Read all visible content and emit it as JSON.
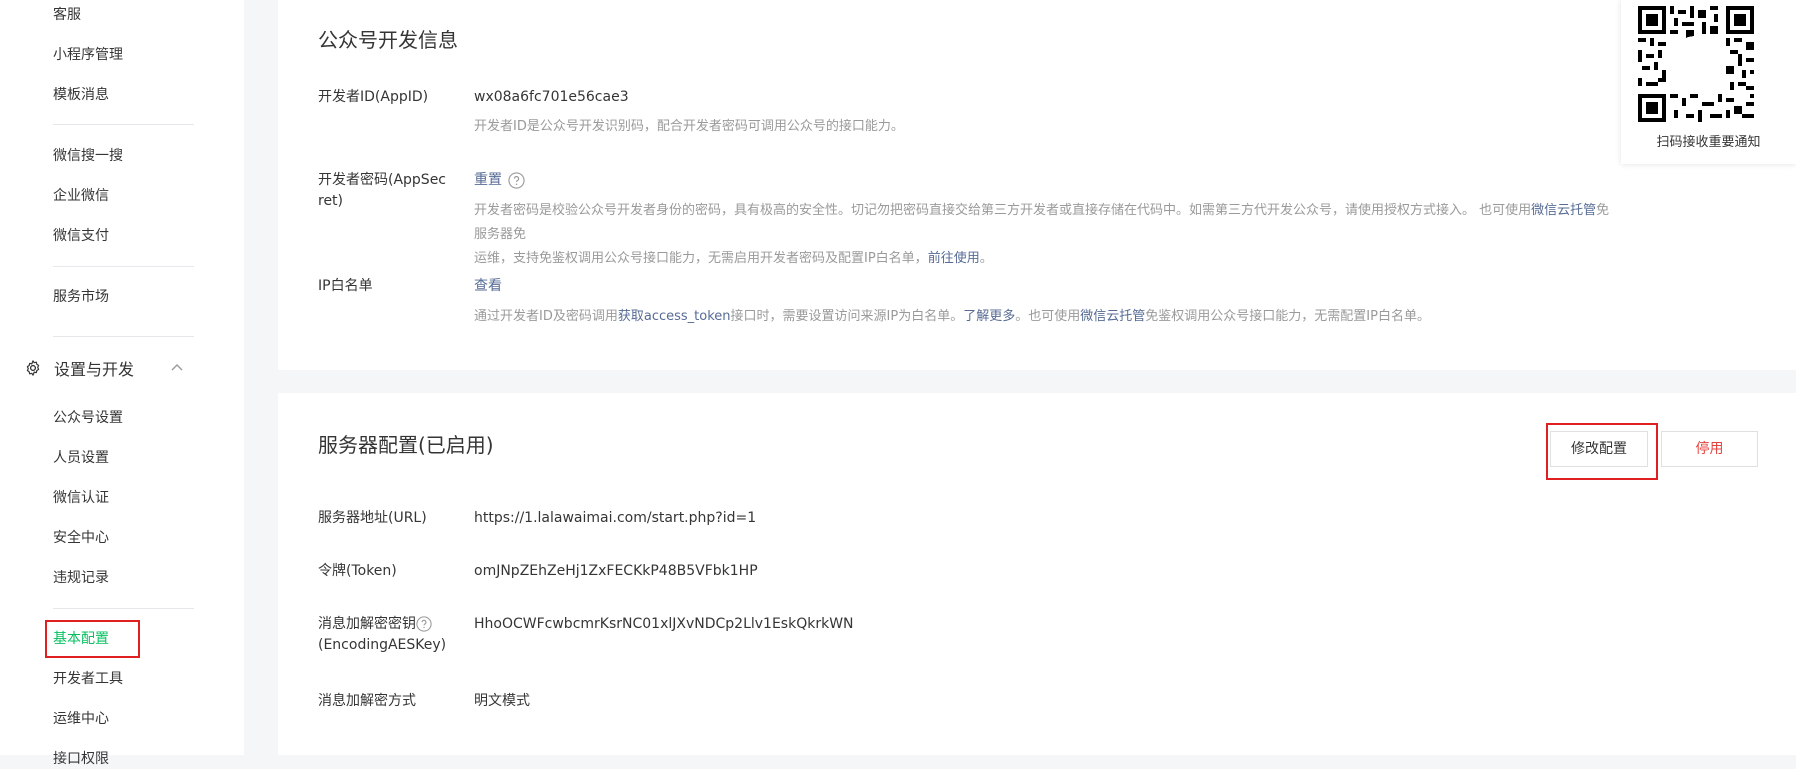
{
  "sidebar": {
    "items_top": [
      "客服",
      "小程序管理",
      "模板消息"
    ],
    "items_group2": [
      "微信搜一搜",
      "企业微信",
      "微信支付"
    ],
    "items_group3": [
      "服务市场"
    ],
    "section_settings": {
      "label": "设置与开发",
      "icon": "gear-icon",
      "expanded": true
    },
    "items_settings": [
      "公众号设置",
      "人员设置",
      "微信认证",
      "安全中心",
      "违规记录"
    ],
    "items_bottom": [
      "基本配置",
      "开发者工具",
      "运维中心",
      "接口权限"
    ],
    "active_item": "基本配置"
  },
  "dev_info": {
    "title": "公众号开发信息",
    "appid_label": "开发者ID(AppID)",
    "appid_value": "wx08a6fc701e56cae3",
    "appid_desc": "开发者ID是公众号开发识别码，配合开发者密码可调用公众号的接口能力。",
    "secret_label_1": "开发者密码(AppSec",
    "secret_label_2": "ret)",
    "secret_reset": "重置",
    "secret_desc_1": "开发者密码是校验公众号开发者身份的密码，具有极高的安全性。切记勿把密码直接交给第三方开发者或直接存储在代码中。如需第三方代开发公众号，请使用授权方式接入。 也可使用",
    "secret_desc_link1": "微信云托管",
    "secret_desc_2": "免服务器免",
    "secret_desc_3": "运维，支持免鉴权调用公众号接口能力，无需启用开发者密码及配置IP白名单，",
    "secret_desc_link2": "前往使用",
    "secret_desc_4": "。",
    "ip_label": "IP白名单",
    "ip_view": "查看",
    "ip_desc_1": "通过开发者ID及密码调用",
    "ip_desc_link1": "获取access_token",
    "ip_desc_2": "接口时，需要设置访问来源IP为白名单。",
    "ip_desc_link2": "了解更多",
    "ip_desc_3": "。也可使用",
    "ip_desc_link3": "微信云托管",
    "ip_desc_4": "免鉴权调用公众号接口能力，无需配置IP白名单。"
  },
  "server_config": {
    "title": "服务器配置(已启用)",
    "edit_button": "修改配置",
    "stop_button": "停用",
    "url_label": "服务器地址(URL)",
    "url_value": "https://1.lalawaimai.com/start.php?id=1",
    "token_label": "令牌(Token)",
    "token_value": "omJNpZEhZeHj1ZxFECKkP48B5VFbk1HP",
    "aes_label_1": "消息加解密密钥",
    "aes_label_2": "(EncodingAESKey)",
    "aes_value": "HhoOCWFcwbcmrKsrNC01xlJXvNDCp2Llv1EskQkrkWN",
    "mode_label": "消息加解密方式",
    "mode_value": "明文模式"
  },
  "qr": {
    "caption": "扫码接收重要通知"
  },
  "colors": {
    "accent_green": "#07c160",
    "link_blue": "#576b95",
    "danger_red": "#e64340",
    "highlight_box": "#e02020"
  }
}
